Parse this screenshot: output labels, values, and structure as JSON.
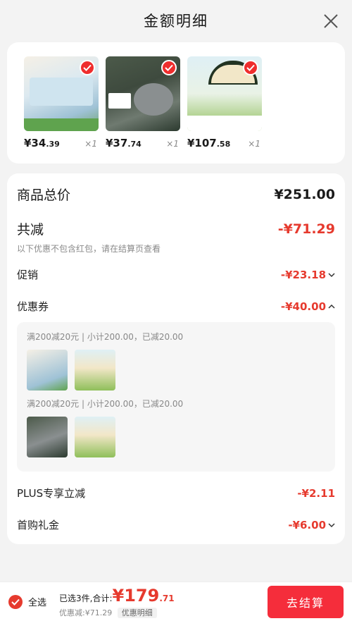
{
  "header": {
    "title": "金额明细"
  },
  "products": [
    {
      "price_int": "¥34",
      "price_dec": ".39",
      "qty": "×1"
    },
    {
      "price_int": "¥37",
      "price_dec": ".74",
      "qty": "×1"
    },
    {
      "price_int": "¥107",
      "price_dec": ".58",
      "qty": "×1"
    }
  ],
  "summary": {
    "total_label": "商品总价",
    "total_value": "¥251.00",
    "discount_label": "共减",
    "discount_value": "-¥71.29",
    "discount_note": "以下优惠不包含红包，请在结算页查看",
    "promo_label": "促销",
    "promo_value": "-¥23.18",
    "coupon_label": "优惠券",
    "coupon_value": "-¥40.00",
    "coupon_lines": [
      "满200减20元 | 小计200.00，已减20.00",
      "满200减20元 | 小计200.00，已减20.00"
    ],
    "plus_label": "PLUS专享立减",
    "plus_value": "-¥2.11",
    "gift_label": "首购礼金",
    "gift_value": "-¥6.00"
  },
  "bottom": {
    "select_all": "全选",
    "selected_text": "已选3件,合计:",
    "total_int": "¥179",
    "total_dec": ".71",
    "discounted_text": "优惠减:¥71.29",
    "detail_tag": "优惠明细",
    "checkout": "去结算"
  },
  "colors": {
    "accent": "#e63a2e",
    "checkout_bg": "#f52d3b"
  },
  "icons": [
    "close-icon",
    "check-icon",
    "chevron-down-icon",
    "chevron-up-icon"
  ]
}
